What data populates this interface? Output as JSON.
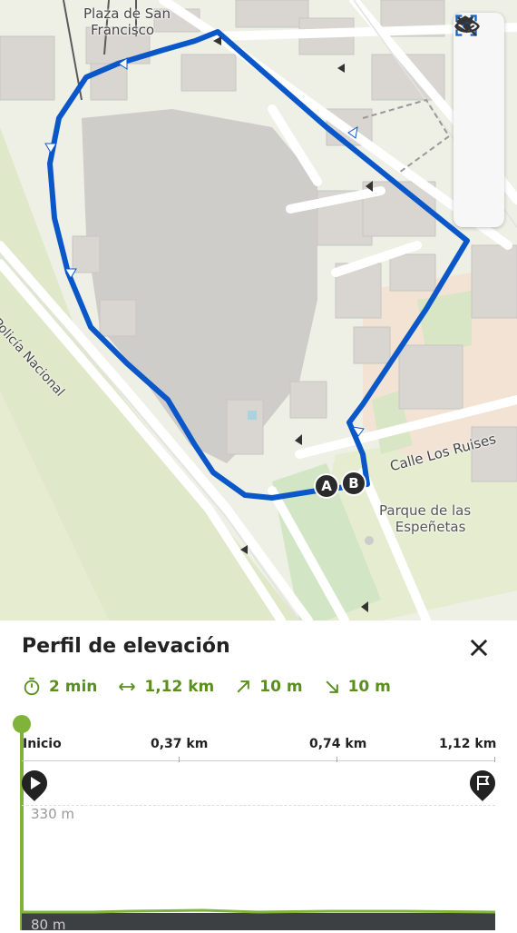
{
  "map": {
    "labels": {
      "plaza": "Plaza de San\nFrancisco",
      "plaza_line1": "Plaza de San",
      "plaza_line2": "Francisco",
      "street_policia": "a Policía Nacional",
      "street_ruises": "Calle Los Ruises",
      "park_line1": "Parque de las",
      "park_line2": "Espeñetas"
    },
    "markers": {
      "start": "A",
      "end": "B"
    },
    "controls": [
      "navigation-arrow-icon",
      "layers-icon",
      "focus-location-icon",
      "visibility-off-icon"
    ],
    "route_color": "#0a57c9"
  },
  "sheet": {
    "title": "Perfil de elevación",
    "stats": {
      "duration": "2 min",
      "distance": "1,12 km",
      "ascent": "10 m",
      "descent": "10 m"
    },
    "distance_ticks": [
      "Inicio",
      "0,37 km",
      "0,74 km",
      "1,12 km"
    ],
    "elevation_ticks": [
      "330 m",
      "80 m"
    ],
    "accent_color": "#7fb33a"
  }
}
